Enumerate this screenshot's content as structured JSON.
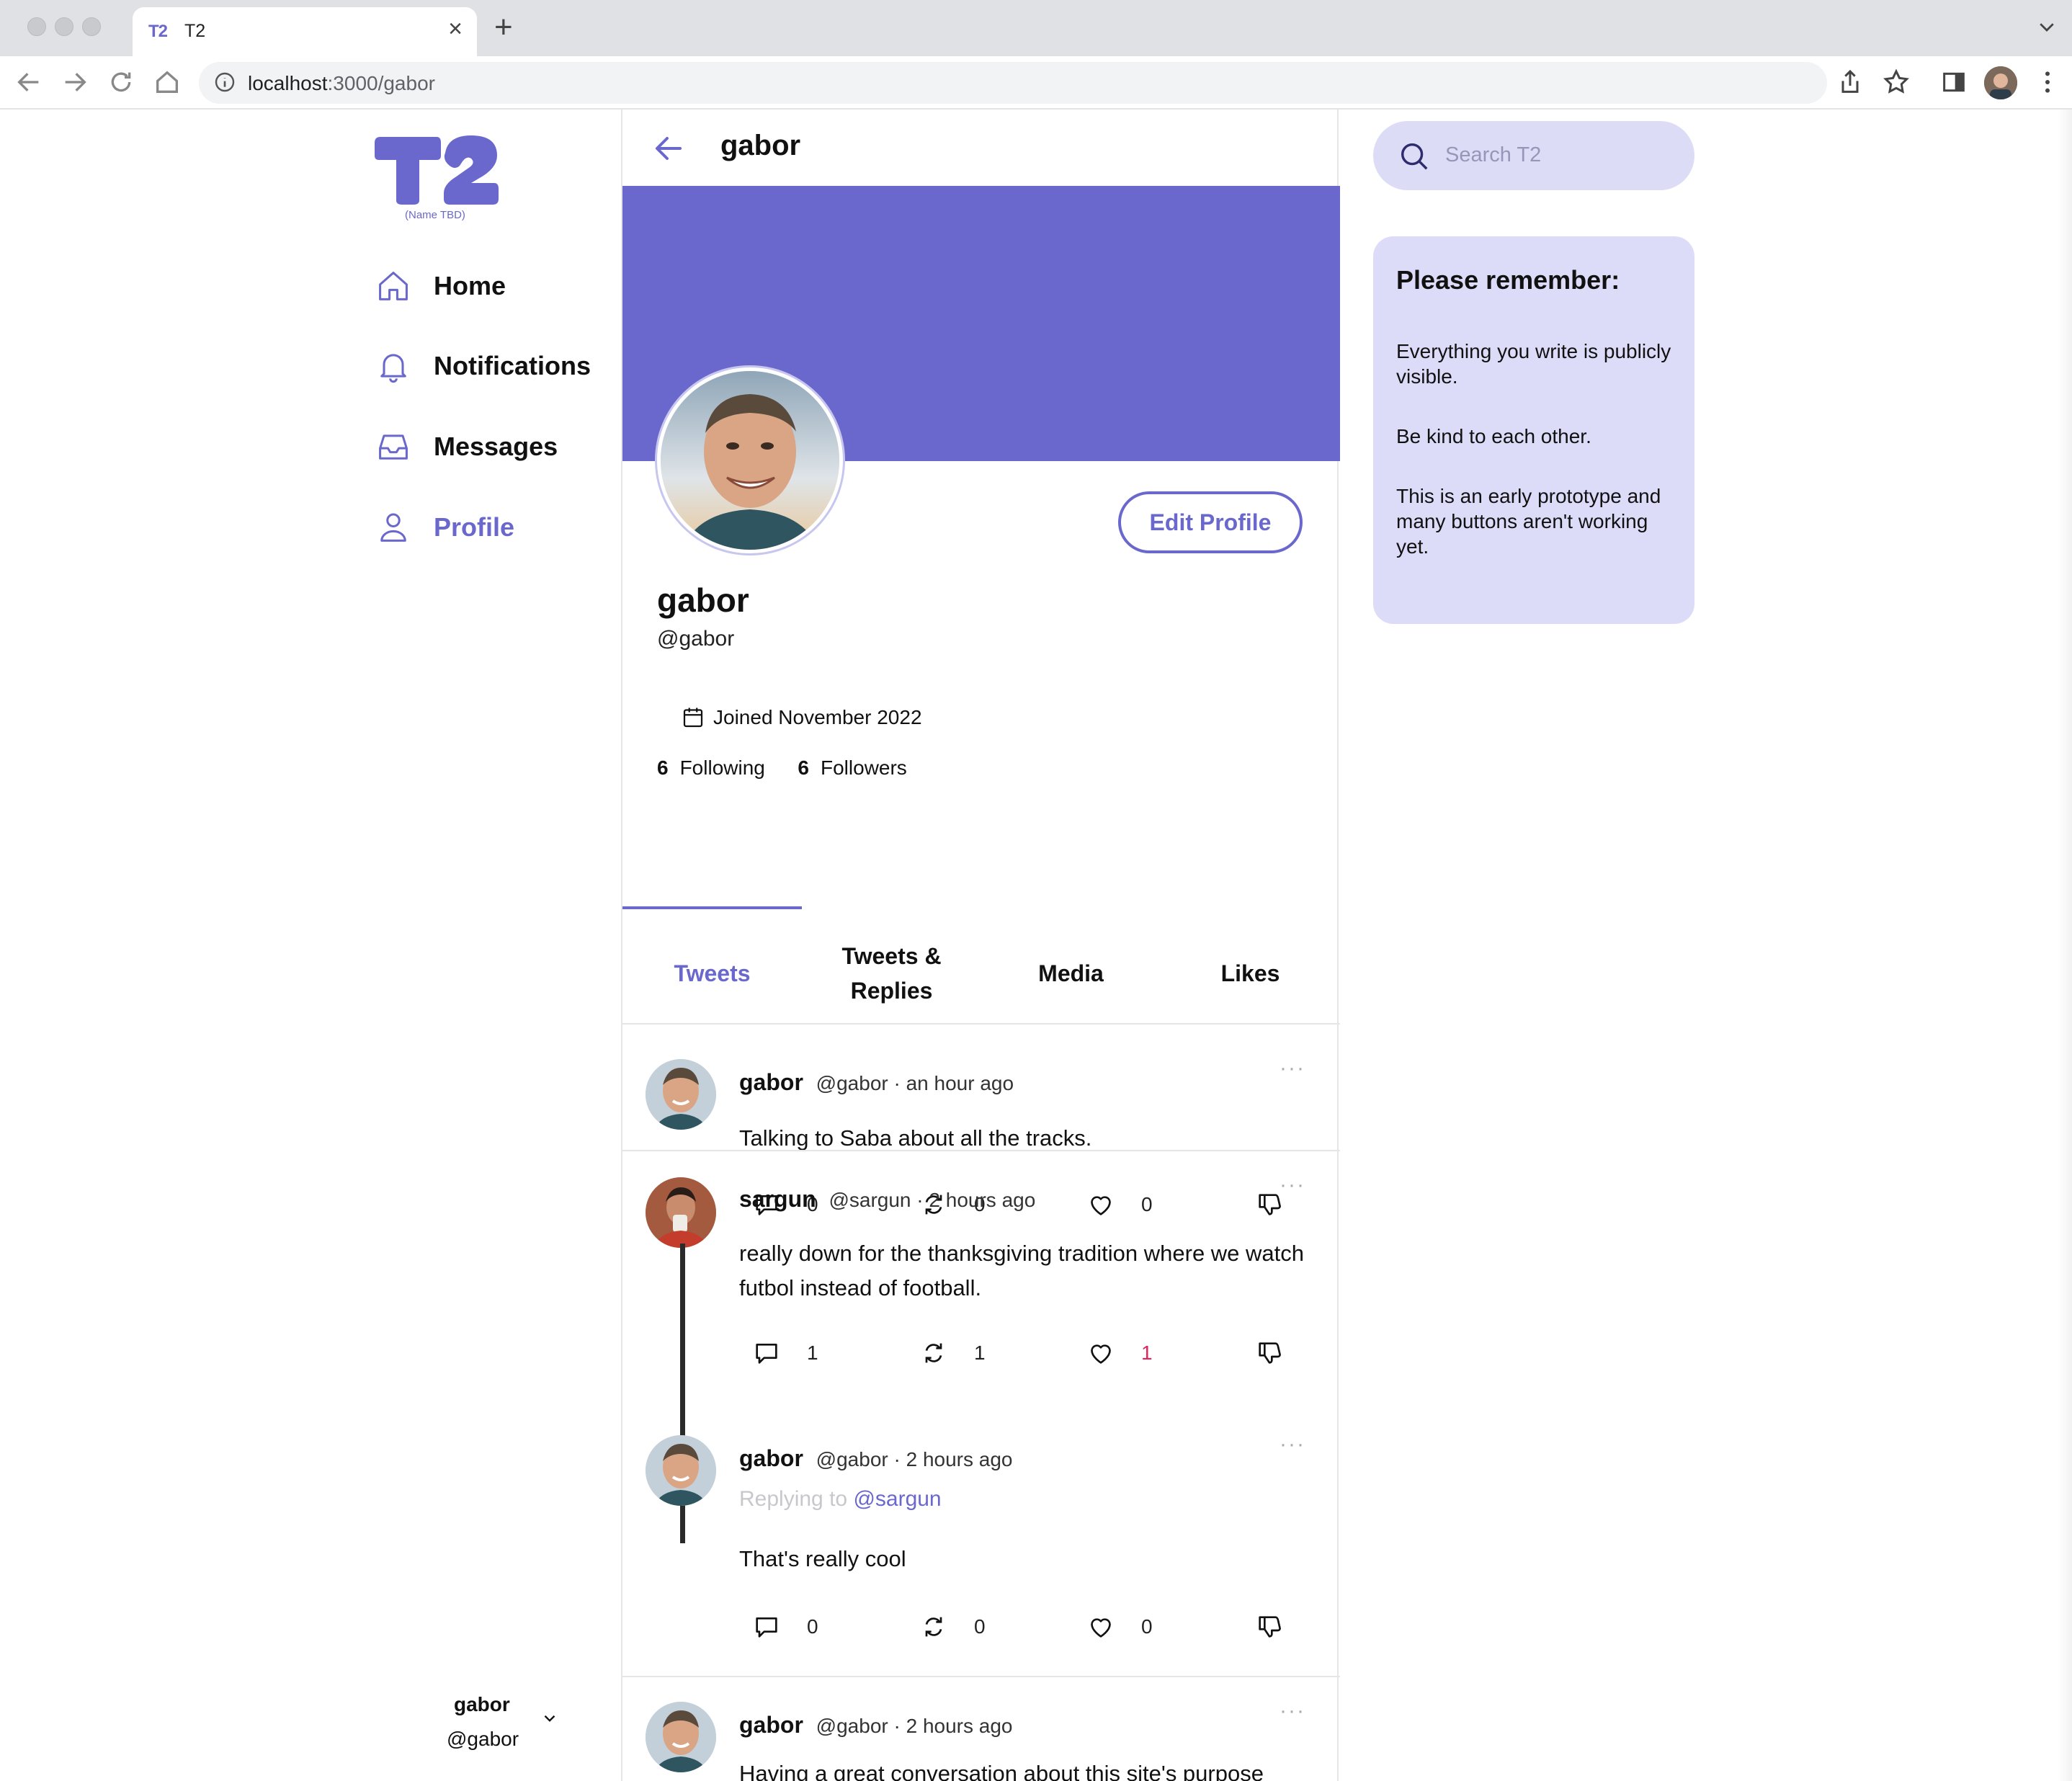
{
  "browser": {
    "tab_title": "T2",
    "tab_favicon": "T2",
    "url_host": "localhost",
    "url_rest": ":3000/gabor"
  },
  "sidebar": {
    "logo_sub": "(Name TBD)",
    "items": [
      {
        "label": "Home",
        "icon": "home-icon"
      },
      {
        "label": "Notifications",
        "icon": "bell-icon"
      },
      {
        "label": "Messages",
        "icon": "inbox-icon"
      },
      {
        "label": "Profile",
        "icon": "user-icon",
        "active": true
      }
    ],
    "account": {
      "name": "gabor",
      "handle": "@gabor"
    }
  },
  "header": {
    "title": "gabor"
  },
  "profile": {
    "name": "gabor",
    "handle": "@gabor",
    "edit_label": "Edit Profile",
    "joined": "Joined November 2022",
    "following_count": "6",
    "following_label": "Following",
    "followers_count": "6",
    "followers_label": "Followers"
  },
  "tabs": [
    {
      "label": "Tweets",
      "active": true
    },
    {
      "label": "Tweets & Replies"
    },
    {
      "label": "Media"
    },
    {
      "label": "Likes"
    }
  ],
  "tweets": [
    {
      "name": "gabor",
      "handle": "@gabor ·",
      "time": "an hour ago",
      "body": "Talking to Saba about all the tracks.",
      "replies": "0",
      "retweets": "0",
      "likes": "0"
    },
    {
      "name": "sargun",
      "handle": "@sargun ·",
      "time": "2 hours ago",
      "body": "really down for the thanksgiving tradition where we watch futbol instead of football.",
      "replies": "1",
      "retweets": "1",
      "likes": "1"
    },
    {
      "name": "gabor",
      "handle": "@gabor ·",
      "time": "2 hours ago",
      "reply_prefix": "Replying to",
      "reply_to": "@sargun",
      "body": "That's really cool",
      "replies": "0",
      "retweets": "0",
      "likes": "0"
    },
    {
      "name": "gabor",
      "handle": "@gabor ·",
      "time": "2 hours ago",
      "body": "Having a great conversation about this site's purpose"
    }
  ],
  "right": {
    "search_placeholder": "Search T2",
    "remember_title": "Please remember:",
    "remember_lines": [
      "Everything you write is publicly visible.",
      "Be kind to each other.",
      "This is an early prototype and many buttons aren't working yet."
    ]
  },
  "colors": {
    "accent": "#6a68cc",
    "like_active": "#e0245e",
    "panel": "#dcdcf9"
  }
}
